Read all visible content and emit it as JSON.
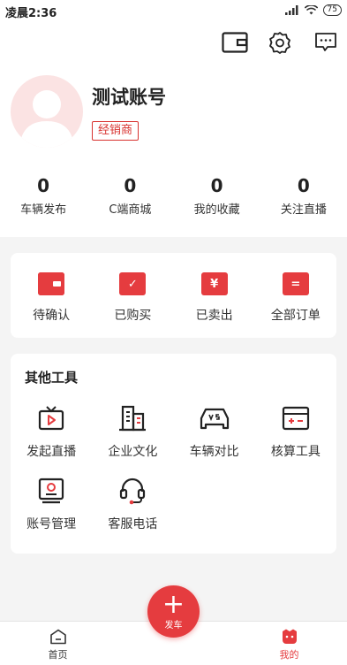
{
  "status_bar": {
    "time": "凌晨2:36",
    "battery": "75"
  },
  "header": {
    "icons": [
      "wallet-icon",
      "gear-icon",
      "message-icon"
    ]
  },
  "profile": {
    "username": "测试账号",
    "role": "经销商"
  },
  "stats": [
    {
      "value": "0",
      "label": "车辆发布"
    },
    {
      "value": "0",
      "label": "C端商城"
    },
    {
      "value": "0",
      "label": "我的收藏"
    },
    {
      "value": "0",
      "label": "关注直播"
    }
  ],
  "orders": [
    {
      "label": "待确认",
      "icon": "wallet-icon",
      "glyph": ""
    },
    {
      "label": "已购买",
      "icon": "check-icon",
      "glyph": "✓"
    },
    {
      "label": "已卖出",
      "icon": "yen-icon",
      "glyph": "¥"
    },
    {
      "label": "全部订单",
      "icon": "list-icon",
      "glyph": "="
    }
  ],
  "tools": {
    "title": "其他工具",
    "items": [
      {
        "label": "发起直播",
        "icon": "live-tv-icon"
      },
      {
        "label": "企业文化",
        "icon": "building-icon"
      },
      {
        "label": "车辆对比",
        "icon": "car-vs-icon"
      },
      {
        "label": "核算工具",
        "icon": "calculator-icon"
      },
      {
        "label": "账号管理",
        "icon": "account-card-icon"
      },
      {
        "label": "客服电话",
        "icon": "headset-icon"
      }
    ]
  },
  "bottom_nav": {
    "home": "首页",
    "publish": "发车",
    "mine": "我的"
  },
  "colors": {
    "accent": "#e53c3f"
  }
}
